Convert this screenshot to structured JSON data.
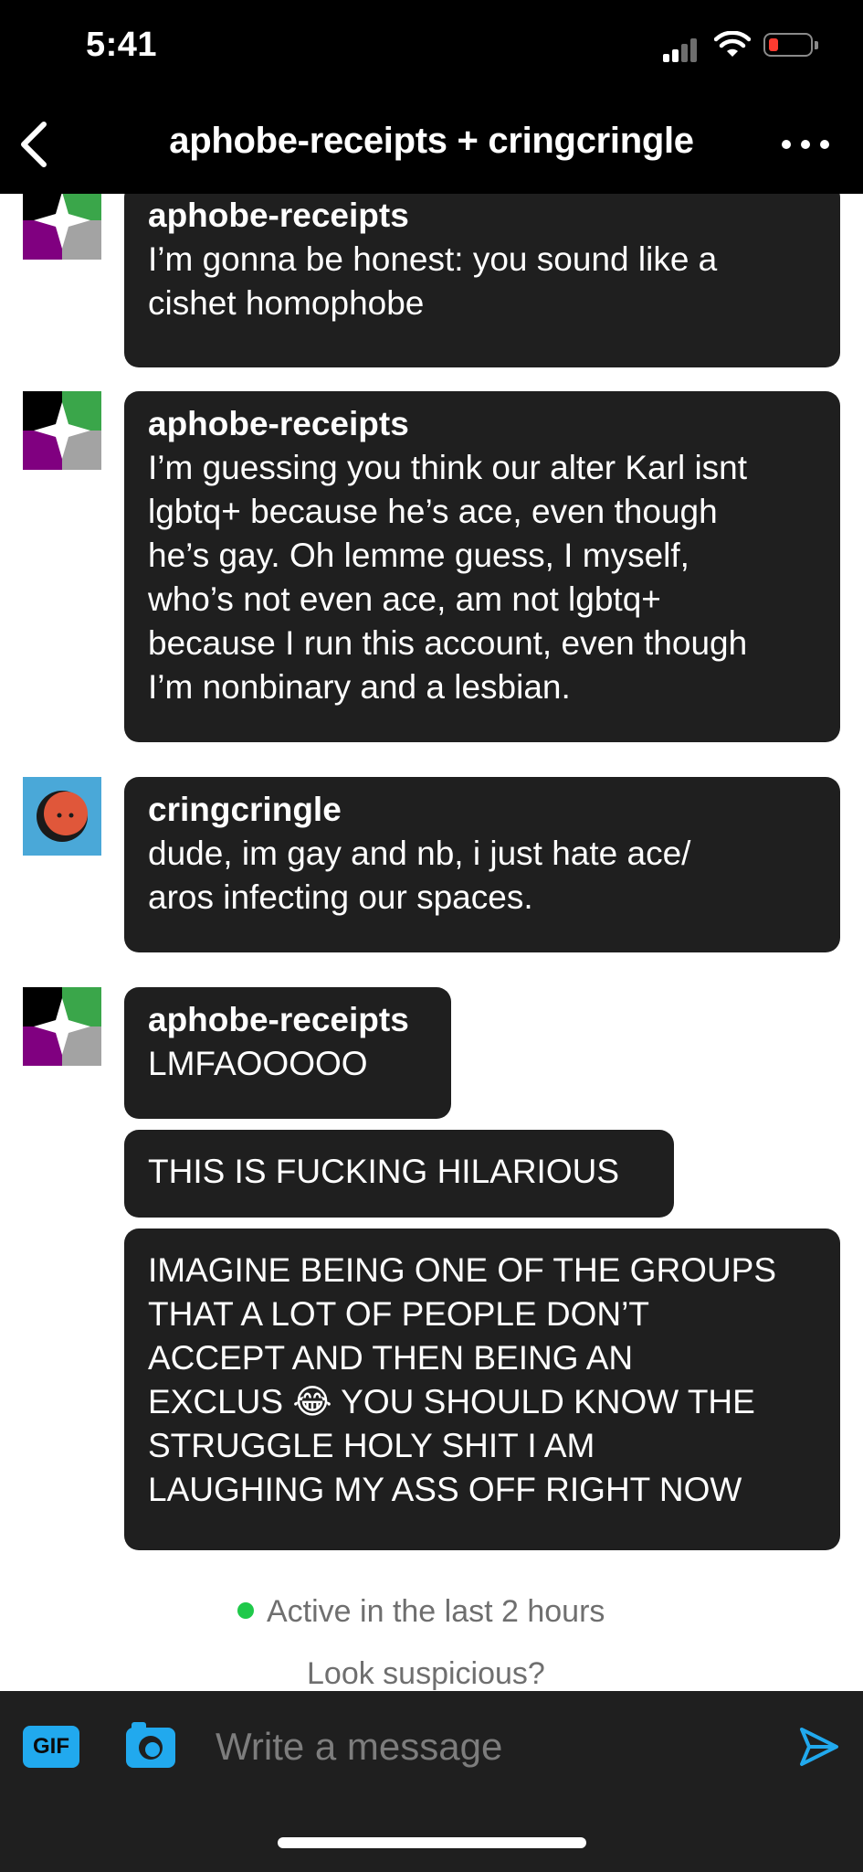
{
  "status": {
    "time": "5:41"
  },
  "header": {
    "title": "aphobe-receipts + cringcringle"
  },
  "messages": [
    {
      "sender": "aphobe-receipts",
      "text": "I’m gonna be honest: you sound like a\ncishet homophobe"
    },
    {
      "sender": "aphobe-receipts",
      "text": "I’m guessing you think our alter Karl isnt\nlgbtq+ because he’s ace, even though\nhe’s gay. Oh lemme guess, I myself,\nwho’s not even ace, am not lgbtq+\nbecause I run this account, even though\nI’m nonbinary and a lesbian."
    },
    {
      "sender": "cringcringle",
      "text": "dude, im gay and nb, i just hate ace/\naros infecting our spaces."
    },
    {
      "sender": "aphobe-receipts",
      "text": "LMFAOOOOO"
    },
    {
      "text": "THIS IS FUCKING HILARIOUS"
    },
    {
      "text": "IMAGINE BEING ONE OF THE GROUPS\nTHAT A LOT OF PEOPLE DON’T\nACCEPT AND THEN BEING AN\nEXCLUS 😂 YOU SHOULD KNOW THE\nSTRUGGLE HOLY SHIT I AM\nLAUGHING MY ASS OFF RIGHT NOW"
    }
  ],
  "activity": {
    "status": "Active in the last 2 hours",
    "hint": "Look suspicious?"
  },
  "composer": {
    "gif_label": "GIF",
    "placeholder": "Write a message"
  },
  "icons": {
    "back": "chevron-left-icon",
    "more": "more-dots-icon",
    "camera": "camera-icon",
    "send": "send-icon",
    "avatar_aphobe": "star-flag-avatar",
    "avatar_cring": "orange-face-avatar"
  },
  "colors": {
    "bubble": "#1f1f1f",
    "accent": "#21a9ee",
    "active_dot": "#1fc94a",
    "battery_low": "#ff3b30"
  }
}
